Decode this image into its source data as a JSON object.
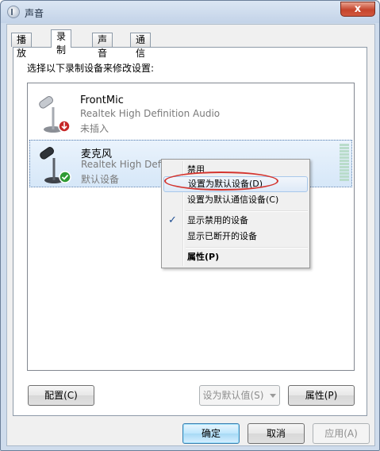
{
  "window": {
    "title": "声音",
    "close_label": "x"
  },
  "tabs": [
    {
      "label": "播放"
    },
    {
      "label": "录制"
    },
    {
      "label": "声音"
    },
    {
      "label": "通信"
    }
  ],
  "instruction": "选择以下录制设备来修改设置:",
  "devices": [
    {
      "name": "FrontMic",
      "driver": "Realtek High Definition Audio",
      "status": "未插入",
      "badge": "unplugged-arrow-icon"
    },
    {
      "name": "麦克风",
      "driver": "Realtek High Defin",
      "status": "默认设备",
      "badge": "green-check-icon"
    }
  ],
  "context_menu": {
    "items": [
      {
        "label": "禁用"
      },
      {
        "label": "设置为默认设备(D)"
      },
      {
        "label": "设置为默认通信设备(C)"
      },
      {
        "label": "显示禁用的设备",
        "checked": true
      },
      {
        "label": "显示已断开的设备"
      },
      {
        "label": "属性(P)"
      }
    ]
  },
  "buttons": {
    "configure": "配置(C)",
    "set_default": "设为默认值(S)",
    "properties": "属性(P)",
    "ok": "确定",
    "cancel": "取消",
    "apply": "应用(A)"
  },
  "colors": {
    "accent": "#3c7fb1",
    "highlight_circle": "#d4352f",
    "selection": "#d6e7f8",
    "status_gray": "#7a7a7a"
  }
}
